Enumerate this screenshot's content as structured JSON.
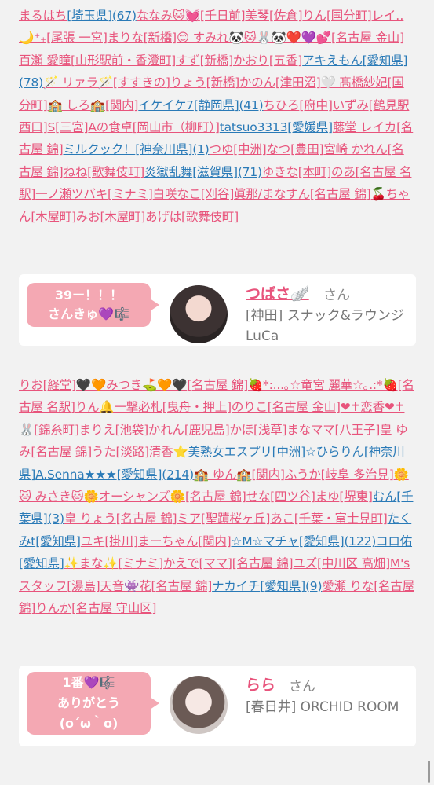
{
  "list1": [
    {
      "t": "まるはち",
      "c": "pink"
    },
    {
      "t": "[埼玉県]",
      "c": "blue"
    },
    {
      "t": "(67)",
      "c": "blue"
    },
    {
      "t": "ななみ🐱💓",
      "c": "pink"
    },
    {
      "t": "[千日前]",
      "c": "pink"
    },
    {
      "t": "美琴",
      "c": "pink"
    },
    {
      "t": "[佐倉]",
      "c": "pink"
    },
    {
      "t": "りん",
      "c": "pink"
    },
    {
      "t": "[国分町]",
      "c": "pink"
    },
    {
      "t": "レイ‥🌙⁺₊",
      "c": "pink"
    },
    {
      "t": "[尾張 一宮]",
      "c": "pink"
    },
    {
      "t": "まりな",
      "c": "pink"
    },
    {
      "t": "[新橋]",
      "c": "pink"
    },
    {
      "t": "😊 すみれ🐼🐱🐰🐼❤️💜💕",
      "c": "pink"
    },
    {
      "t": "[名古屋 金山]",
      "c": "pink"
    },
    {
      "t": "百瀬 愛瞳",
      "c": "pink"
    },
    {
      "t": "[山形駅前・香澄町]",
      "c": "pink"
    },
    {
      "t": "すず",
      "c": "pink"
    },
    {
      "t": "[新橋]",
      "c": "pink"
    },
    {
      "t": "かおり",
      "c": "pink"
    },
    {
      "t": "[五香]",
      "c": "pink"
    },
    {
      "t": "アキえもん",
      "c": "blue"
    },
    {
      "t": "[愛知県]",
      "c": "blue"
    },
    {
      "t": "(78)",
      "c": "blue"
    },
    {
      "t": "🪄 リァラ🪄",
      "c": "pink"
    },
    {
      "t": "[すすきの]",
      "c": "pink"
    },
    {
      "t": "りょう",
      "c": "pink"
    },
    {
      "t": "[新橋]",
      "c": "pink"
    },
    {
      "t": "かのん",
      "c": "pink"
    },
    {
      "t": "[津田沼]",
      "c": "pink"
    },
    {
      "t": "🤍 髙橋紗妃",
      "c": "pink"
    },
    {
      "t": "[国分町]",
      "c": "pink"
    },
    {
      "t": "🏫 しろ🏫",
      "c": "pink"
    },
    {
      "t": "[関内]",
      "c": "pink"
    },
    {
      "t": "イケイケ7",
      "c": "blue"
    },
    {
      "t": "[静岡県]",
      "c": "blue"
    },
    {
      "t": "(41)",
      "c": "blue"
    },
    {
      "t": "ちひろ",
      "c": "pink"
    },
    {
      "t": "[府中]",
      "c": "pink"
    },
    {
      "t": "いずみ",
      "c": "pink"
    },
    {
      "t": "[鶴見駅西口]",
      "c": "pink"
    },
    {
      "t": "S",
      "c": "pink"
    },
    {
      "t": "[三宮]",
      "c": "pink"
    },
    {
      "t": "Aの食卓",
      "c": "pink"
    },
    {
      "t": "[岡山市（柳町）]",
      "c": "pink"
    },
    {
      "t": "tatsuo3313",
      "c": "blue"
    },
    {
      "t": "[愛媛県]",
      "c": "blue"
    },
    {
      "t": "藤堂 レイカ",
      "c": "pink"
    },
    {
      "t": "[名古屋 錦]",
      "c": "pink"
    },
    {
      "t": "ミルクック！",
      "c": "blue"
    },
    {
      "t": "[神奈川県]",
      "c": "blue"
    },
    {
      "t": "(1)",
      "c": "blue"
    },
    {
      "t": "つゆ",
      "c": "pink"
    },
    {
      "t": "[中洲]",
      "c": "pink"
    },
    {
      "t": "なつ",
      "c": "pink"
    },
    {
      "t": "[豊田]",
      "c": "pink"
    },
    {
      "t": "宮崎 かれん",
      "c": "pink"
    },
    {
      "t": "[名古屋 錦]",
      "c": "pink"
    },
    {
      "t": "ねね",
      "c": "pink"
    },
    {
      "t": "[歌舞伎町]",
      "c": "pink"
    },
    {
      "t": "炎獄乱舞",
      "c": "blue"
    },
    {
      "t": "[滋賀県]",
      "c": "blue"
    },
    {
      "t": "(71)",
      "c": "blue"
    },
    {
      "t": "ゆきな",
      "c": "pink"
    },
    {
      "t": "[本町]",
      "c": "pink"
    },
    {
      "t": "のあ",
      "c": "pink"
    },
    {
      "t": "[名古屋 名駅]",
      "c": "pink"
    },
    {
      "t": "一ノ瀬ツバキ",
      "c": "pink"
    },
    {
      "t": "[ミナミ]",
      "c": "pink"
    },
    {
      "t": "白咲なこ",
      "c": "pink"
    },
    {
      "t": "[刈谷]",
      "c": "pink"
    },
    {
      "t": "眞那/まなすん",
      "c": "pink"
    },
    {
      "t": "[名古屋 錦]",
      "c": "pink"
    },
    {
      "t": "🍒ちゃん",
      "c": "pink"
    },
    {
      "t": "[木屋町]",
      "c": "pink"
    },
    {
      "t": "みお",
      "c": "pink"
    },
    {
      "t": "[木屋町]",
      "c": "pink"
    },
    {
      "t": "あげは",
      "c": "pink"
    },
    {
      "t": "[歌舞伎町]",
      "c": "pink"
    }
  ],
  "card1": {
    "bubble_line1": "39ー！！！",
    "bubble_line2": "さんきゅ💜🎼",
    "name": "つばさ🪽",
    "suffix": "さん",
    "shop": "[神田] スナック&ラウンジ LuCa"
  },
  "list2": [
    {
      "t": "りお",
      "c": "pink"
    },
    {
      "t": "[経堂]",
      "c": "pink"
    },
    {
      "t": "🖤🧡みつき⛳️🧡🖤",
      "c": "pink"
    },
    {
      "t": "[名古屋 錦]",
      "c": "pink"
    },
    {
      "t": "🍓*:...｡☆竜宮 麗華☆｡.:*🍓",
      "c": "pink"
    },
    {
      "t": "[名古屋 名駅]",
      "c": "pink"
    },
    {
      "t": "りん🔔",
      "c": "pink"
    },
    {
      "t": "一撃必札",
      "c": "pink"
    },
    {
      "t": "[曳舟・押上]",
      "c": "pink"
    },
    {
      "t": "のりこ",
      "c": "pink"
    },
    {
      "t": "[名古屋 金山]",
      "c": "pink"
    },
    {
      "t": "❤︎✝︎恋香❤︎✝︎🐰",
      "c": "pink"
    },
    {
      "t": "[錦糸町]",
      "c": "pink"
    },
    {
      "t": "まりえ",
      "c": "pink"
    },
    {
      "t": "[池袋]",
      "c": "pink"
    },
    {
      "t": "かれん",
      "c": "pink"
    },
    {
      "t": "[鹿児島]",
      "c": "pink"
    },
    {
      "t": "かほ",
      "c": "pink"
    },
    {
      "t": "[浅草]",
      "c": "pink"
    },
    {
      "t": "まなママ",
      "c": "pink"
    },
    {
      "t": "[八王子]",
      "c": "pink"
    },
    {
      "t": "皇 ゆみ",
      "c": "pink"
    },
    {
      "t": "[名古屋 錦]",
      "c": "pink"
    },
    {
      "t": "うた",
      "c": "pink"
    },
    {
      "t": "[淡路]",
      "c": "pink"
    },
    {
      "t": "清香⭐️",
      "c": "pink"
    },
    {
      "t": "美熟女エスプリ",
      "c": "blue"
    },
    {
      "t": "[中洲]",
      "c": "blue"
    },
    {
      "t": "☆ひらりん",
      "c": "blue"
    },
    {
      "t": "[神奈川県]",
      "c": "blue"
    },
    {
      "t": "A.Senna★★★",
      "c": "blue"
    },
    {
      "t": "[愛知県]",
      "c": "blue"
    },
    {
      "t": "(214)",
      "c": "blue"
    },
    {
      "t": "🏫 ゆん🏫",
      "c": "pink"
    },
    {
      "t": "[関内]",
      "c": "pink"
    },
    {
      "t": "ふうか",
      "c": "pink"
    },
    {
      "t": "[岐阜 多治見]",
      "c": "pink"
    },
    {
      "t": "🌼🐱 みさき🐱🌼",
      "c": "pink"
    },
    {
      "t": "オーシャンズ🌼",
      "c": "pink"
    },
    {
      "t": "[名古屋 錦]",
      "c": "pink"
    },
    {
      "t": "せな",
      "c": "pink"
    },
    {
      "t": "[四ツ谷]",
      "c": "pink"
    },
    {
      "t": "まゆ",
      "c": "pink"
    },
    {
      "t": "[堺東]",
      "c": "pink"
    },
    {
      "t": "むん",
      "c": "blue"
    },
    {
      "t": "[千葉県]",
      "c": "blue"
    },
    {
      "t": "(3)",
      "c": "blue"
    },
    {
      "t": "皇 りょう",
      "c": "pink"
    },
    {
      "t": "[名古屋 錦]",
      "c": "pink"
    },
    {
      "t": "ミア",
      "c": "pink"
    },
    {
      "t": "[聖蹟桜ヶ丘]",
      "c": "pink"
    },
    {
      "t": "あこ",
      "c": "pink"
    },
    {
      "t": "[千葉・富士見町]",
      "c": "pink"
    },
    {
      "t": "たくみt",
      "c": "blue"
    },
    {
      "t": "[愛知県]",
      "c": "blue"
    },
    {
      "t": "ユキ",
      "c": "pink"
    },
    {
      "t": "[掛川]",
      "c": "pink"
    },
    {
      "t": "まーちゃん",
      "c": "pink"
    },
    {
      "t": "[関内]",
      "c": "pink"
    },
    {
      "t": "☆M☆マチャ",
      "c": "blue"
    },
    {
      "t": "[愛知県]",
      "c": "blue"
    },
    {
      "t": "(122)",
      "c": "blue"
    },
    {
      "t": "コロ佑",
      "c": "blue"
    },
    {
      "t": "[愛知県]",
      "c": "blue"
    },
    {
      "t": "✨まな✨",
      "c": "pink"
    },
    {
      "t": "[ミナミ]",
      "c": "pink"
    },
    {
      "t": "かえで",
      "c": "pink"
    },
    {
      "t": "[ママ]",
      "c": "pink"
    },
    {
      "t": "[名古屋 錦]",
      "c": "pink"
    },
    {
      "t": "ユズ",
      "c": "pink"
    },
    {
      "t": "[中川区 高畑]",
      "c": "pink"
    },
    {
      "t": "M's スタッフ",
      "c": "pink"
    },
    {
      "t": "[湯島]",
      "c": "pink"
    },
    {
      "t": "天音👾花",
      "c": "pink"
    },
    {
      "t": "[名古屋 錦]",
      "c": "pink"
    },
    {
      "t": "ナカイチ",
      "c": "blue"
    },
    {
      "t": "[愛知県]",
      "c": "blue"
    },
    {
      "t": "(9)",
      "c": "blue"
    },
    {
      "t": "愛瀬 りな",
      "c": "pink"
    },
    {
      "t": "[名古屋 錦]",
      "c": "pink"
    },
    {
      "t": "りんか",
      "c": "pink"
    },
    {
      "t": "[名古屋 守山区]",
      "c": "pink"
    }
  ],
  "card2": {
    "bubble_line1": "1番💜🎼",
    "bubble_line2": "ありがとう",
    "bubble_line3": "(o´ω｀o)",
    "name": "らら",
    "suffix": "さん",
    "shop": "[春日井] ORCHID ROOM"
  },
  "colors": {
    "pink": "#e8547c",
    "blue": "#2a7ab7",
    "bubble": "#f4a8b3"
  }
}
